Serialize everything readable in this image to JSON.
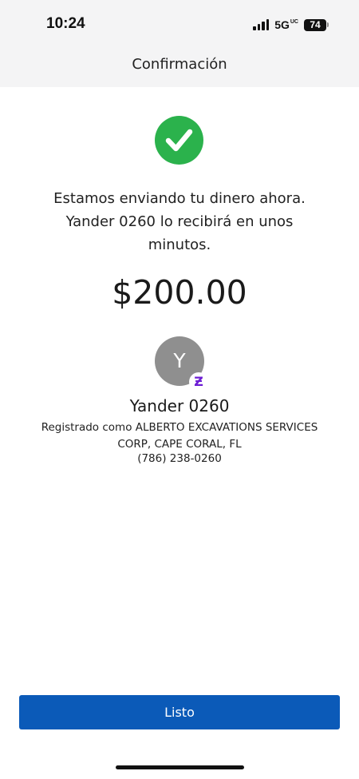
{
  "status_bar": {
    "time": "10:24",
    "network": "5G",
    "network_suffix": "UC",
    "battery": "74"
  },
  "nav": {
    "title": "Confirmación"
  },
  "success_icon": "checkmark-icon",
  "message": {
    "line1": "Estamos enviando tu dinero ahora.",
    "line2": "Yander 0260 lo recibirá en unos",
    "line3": "minutos."
  },
  "amount": "$200.00",
  "recipient": {
    "initial": "Y",
    "badge": "Ƶ",
    "name": "Yander 0260",
    "registered_line1": "Registrado como ALBERTO EXCAVATIONS SERVICES",
    "registered_line2": "CORP, CAPE CORAL, FL",
    "phone": "(786) 238-0260"
  },
  "actions": {
    "done_label": "Listo"
  },
  "colors": {
    "accent": "#0b5ab8",
    "success": "#2bb24c",
    "avatar": "#8f8f8f",
    "zelle": "#6d1ed4",
    "header_bg": "#f4f4f5"
  }
}
